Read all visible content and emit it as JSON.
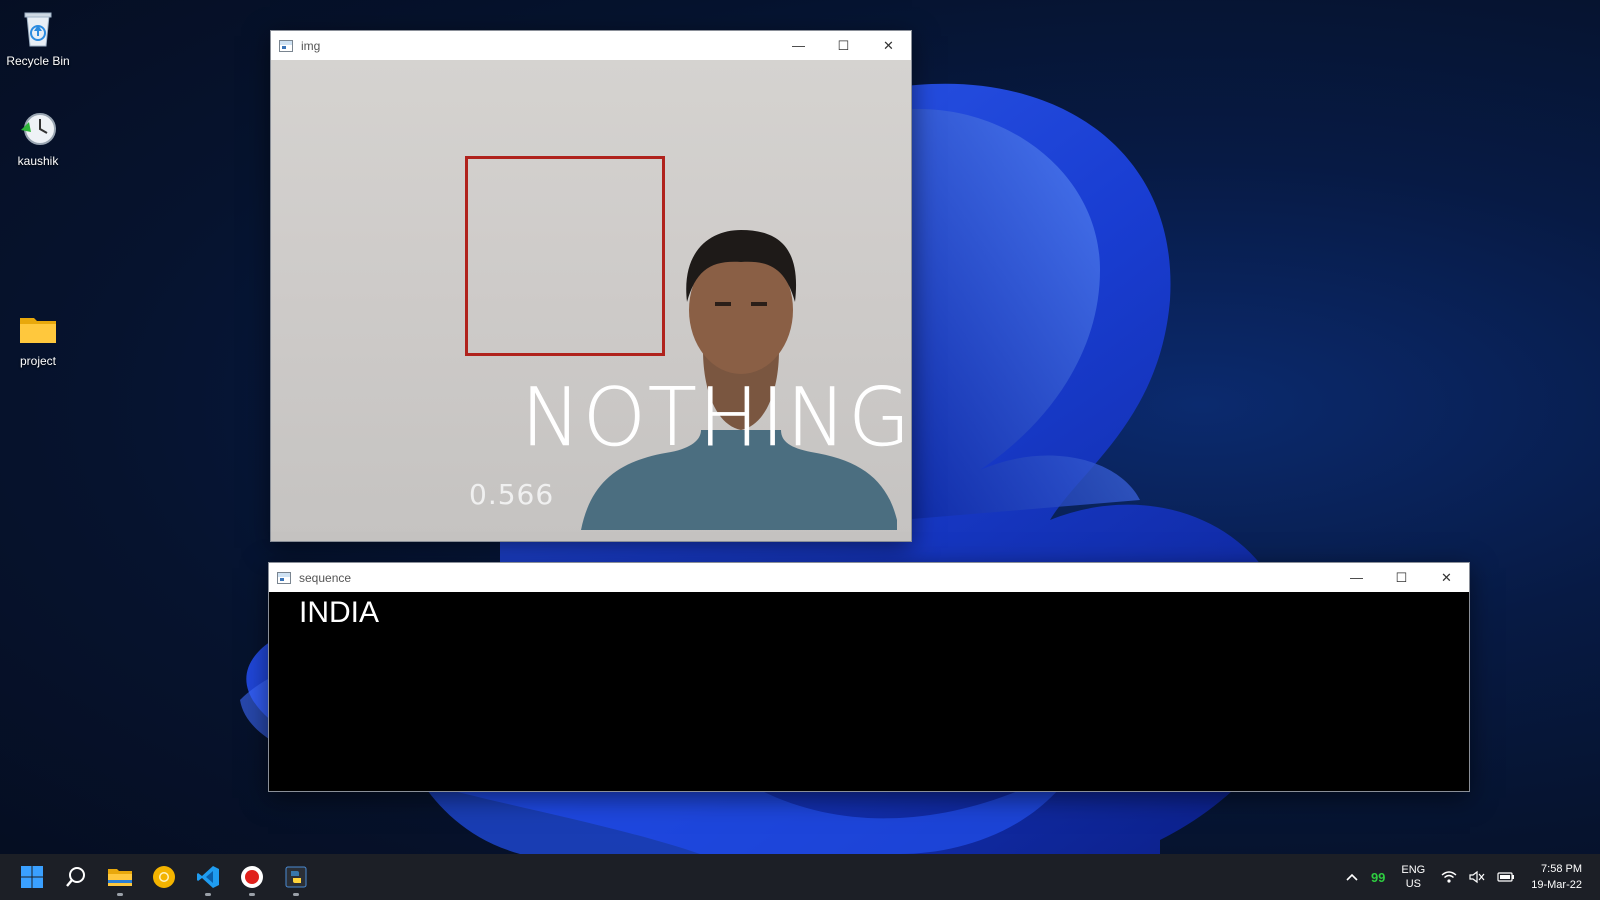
{
  "desktop": {
    "icons": [
      {
        "label": "Recycle Bin",
        "icon": "recycle-bin-icon"
      },
      {
        "label": "kaushik",
        "icon": "clock-restore-icon"
      },
      {
        "label": "project",
        "icon": "folder-icon"
      }
    ]
  },
  "img_window": {
    "title": "img",
    "prediction": "NOTHING",
    "confidence": "0.566",
    "roi_color": "#b0221c"
  },
  "sequence_window": {
    "title": "sequence",
    "text": "INDIA"
  },
  "window_controls": {
    "minimize": "—",
    "maximize": "☐",
    "close": "✕"
  },
  "taskbar": {
    "apps": [
      {
        "name": "start",
        "icon": "windows-start-icon"
      },
      {
        "name": "search",
        "icon": "search-icon"
      },
      {
        "name": "file-explorer",
        "icon": "folder-icon",
        "running": true
      },
      {
        "name": "chrome-canary",
        "icon": "browser-icon"
      },
      {
        "name": "vscode",
        "icon": "vscode-icon",
        "running": true
      },
      {
        "name": "recorder",
        "icon": "record-icon",
        "running": true
      },
      {
        "name": "python",
        "icon": "python-icon",
        "running": true
      }
    ],
    "tray": {
      "battery_badge": "99",
      "lang_top": "ENG",
      "lang_bottom": "US",
      "time": "7:58 PM",
      "date": "19-Mar-22"
    }
  }
}
